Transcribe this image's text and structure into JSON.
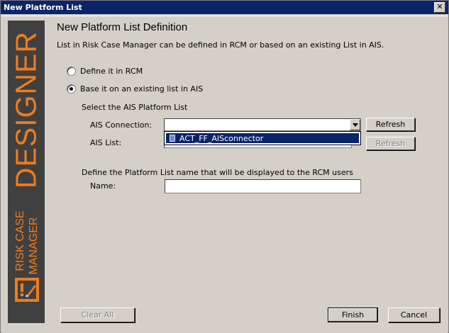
{
  "window": {
    "title": "New Platform List",
    "close_glyph": "✕"
  },
  "banner": {
    "designer": "DESIGNER",
    "risk_case": "RISK CASE",
    "manager": "MANAGER",
    "brand_color": "#f07c1c",
    "background_color": "#404040"
  },
  "header": {
    "title": "New Platform List Definition",
    "description": "List in Risk Case Manager can be defined in RCM or based on an existing List in AIS."
  },
  "options": {
    "define_rcm": {
      "label": "Define it in RCM",
      "selected": false
    },
    "base_ais": {
      "label": "Base it on an existing list in AIS",
      "selected": true
    }
  },
  "ais": {
    "section_label": "Select the AIS Platform List",
    "connection_label": "AIS Connection:",
    "connection_value": "",
    "dropdown_options": [
      "ACT_FF_AISconnector"
    ],
    "list_label": "AIS List:",
    "refresh_label": "Refresh",
    "refresh2_label": "Refresh"
  },
  "name_section": {
    "description": "Define the Platform List name that will be displayed to the RCM users",
    "name_label": "Name:",
    "name_value": ""
  },
  "buttons": {
    "clear_all": "Clear All",
    "finish": "Finish",
    "cancel": "Cancel"
  },
  "colors": {
    "titlebar": "#0a246a",
    "selection": "#0a246a",
    "window_bg": "#d4d0c8"
  }
}
